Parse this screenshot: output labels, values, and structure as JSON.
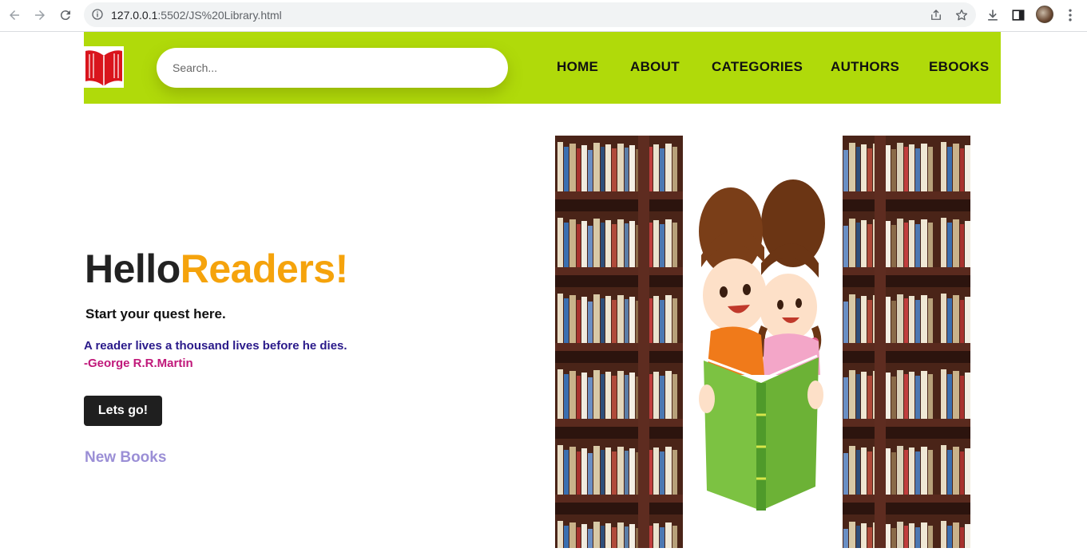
{
  "browser": {
    "url_host": "127.0.0.1",
    "url_rest": ":5502/JS%20Library.html"
  },
  "site": {
    "search_placeholder": "Search...",
    "menu": [
      "HOME",
      "ABOUT",
      "CATEGORIES",
      "AUTHORS",
      "EBOOKS"
    ]
  },
  "hero": {
    "title_part1": "Hello",
    "title_part2": "Readers!",
    "tagline": "Start your quest here.",
    "quote": "A reader lives a thousand lives before he dies.",
    "author": "-George R.R.Martin",
    "cta_label": "Lets go!",
    "new_books": "New Books"
  },
  "colors": {
    "header_bg": "#b0da0a",
    "title_accent": "#f5a30c",
    "quote": "#2a1a8a",
    "author": "#c0187a",
    "new_books": "#9b8fd6"
  },
  "icons": [
    "back-arrow-icon",
    "forward-arrow-icon",
    "reload-icon",
    "info-icon",
    "share-icon",
    "star-icon",
    "download-icon",
    "side-panel-icon",
    "more-menu-icon",
    "book-logo-icon"
  ]
}
